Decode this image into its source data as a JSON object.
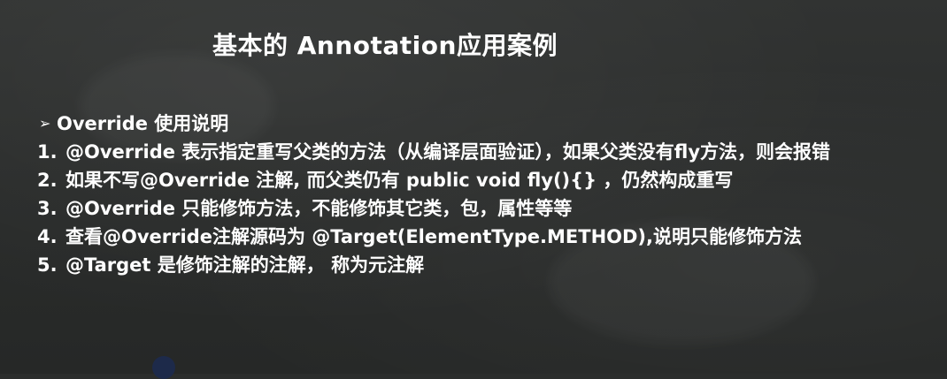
{
  "title": "基本的 Annotation应用案例",
  "heading": {
    "bullet": "➢",
    "text": "Override 使用说明"
  },
  "items": [
    {
      "num": "1.",
      "text": "@Override 表示指定重写父类的方法（从编译层面验证），如果父类没有fly方法，则会报错"
    },
    {
      "num": "2.",
      "text": "如果不写@Override 注解, 而父类仍有 public void fly(){} ，仍然构成重写"
    },
    {
      "num": "3.",
      "text": "@Override 只能修饰方法，不能修饰其它类，包，属性等等"
    },
    {
      "num": "4.",
      "text": "查看@Override注解源码为 @Target(ElementType.METHOD),说明只能修饰方法"
    },
    {
      "num": "5.",
      "text": "@Target 是修饰注解的注解， 称为元注解"
    }
  ]
}
